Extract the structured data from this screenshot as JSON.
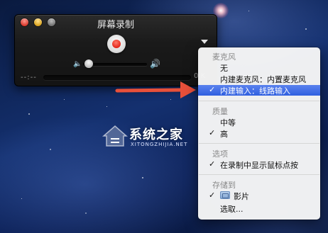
{
  "window": {
    "title": "屏幕录制",
    "timecode": "--:--",
    "size_readout": "0 K"
  },
  "menu": {
    "sections": {
      "microphone": {
        "title": "麦克风",
        "items": [
          {
            "label": "无",
            "checked": false
          },
          {
            "label": "内建麦克风：内置麦克风",
            "checked": false
          },
          {
            "label": "内建输入：线路输入",
            "checked": true,
            "highlighted": true
          }
        ]
      },
      "quality": {
        "title": "质量",
        "items": [
          {
            "label": "中等",
            "checked": false
          },
          {
            "label": "高",
            "checked": true
          }
        ]
      },
      "options": {
        "title": "选项",
        "items": [
          {
            "label": "在录制中显示鼠标点按",
            "checked": true
          }
        ]
      },
      "save_to": {
        "title": "存储到",
        "items": [
          {
            "label": "影片",
            "checked": true,
            "icon": "folder-icon"
          },
          {
            "label": "选取...",
            "checked": false
          }
        ]
      }
    },
    "check_glyph": "✓"
  },
  "watermark": {
    "text": "系统之家",
    "subtext": "XITONGZHIJIA.NET"
  },
  "colors": {
    "highlight": "#2f5fe0",
    "annotation_arrow": "#e8503a",
    "record_red": "#e3261a"
  }
}
